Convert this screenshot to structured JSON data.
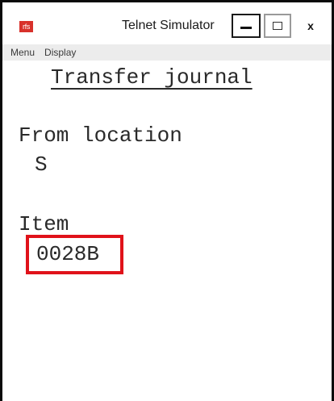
{
  "window": {
    "app_badge": "rfs",
    "title": "Telnet Simulator",
    "close_glyph": "x"
  },
  "menu": {
    "items": [
      {
        "label": "Menu"
      },
      {
        "label": "Display"
      }
    ]
  },
  "screen": {
    "title": "Transfer journal",
    "from_location_label": "From location",
    "from_location_value": "S",
    "item_label": "Item",
    "item_value": "0028B"
  },
  "colors": {
    "highlight_border": "#e0121a",
    "app_badge_bg": "#d8312b"
  }
}
